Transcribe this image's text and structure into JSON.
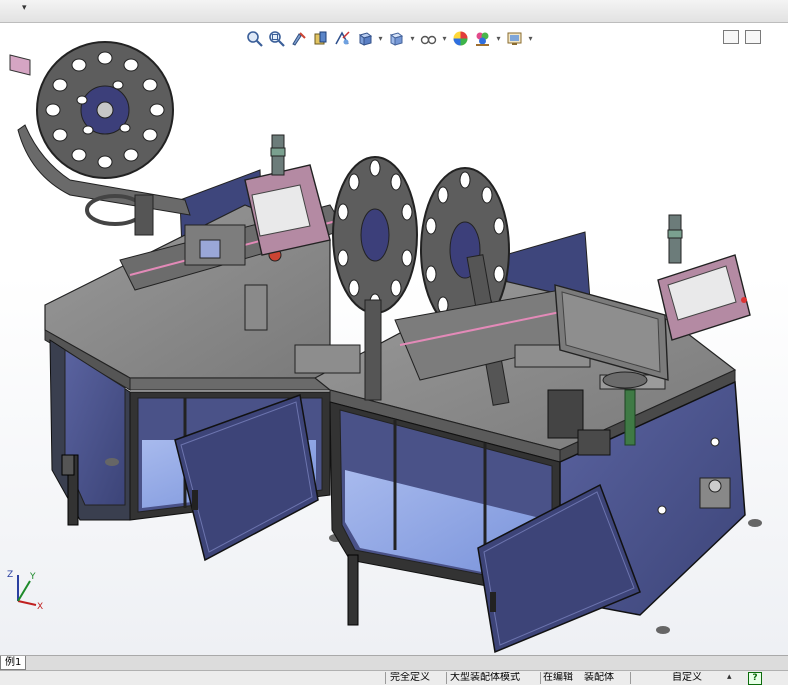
{
  "window": {
    "top_dropdown": "▾"
  },
  "headsup_toolbar": {
    "icons": [
      "zoom-to-fit-icon",
      "zoom-area-icon",
      "previous-view-icon",
      "section-view-icon",
      "dynamic-annotation-icon",
      "view-orientation-icon",
      "display-style-icon",
      "hide-show-items-icon",
      "edit-appearance-icon",
      "apply-scene-icon",
      "view-settings-icon"
    ]
  },
  "model_tabs": {
    "active_tab": "例1"
  },
  "status_bar": {
    "definition": "完全定义",
    "mode": "大型装配体模式",
    "editing": "在编辑",
    "document": "装配体",
    "units": "自定义",
    "help": "?"
  },
  "colors": {
    "frame": "#3a3f4f",
    "panel": "#4a5288",
    "tabletop": "#8c8c8c",
    "reel": "#5d5d5d",
    "hmi": "#b48aa3",
    "glass": "#9fb6ff"
  },
  "triad": {
    "x": "X",
    "y": "Y",
    "z": "Z"
  }
}
